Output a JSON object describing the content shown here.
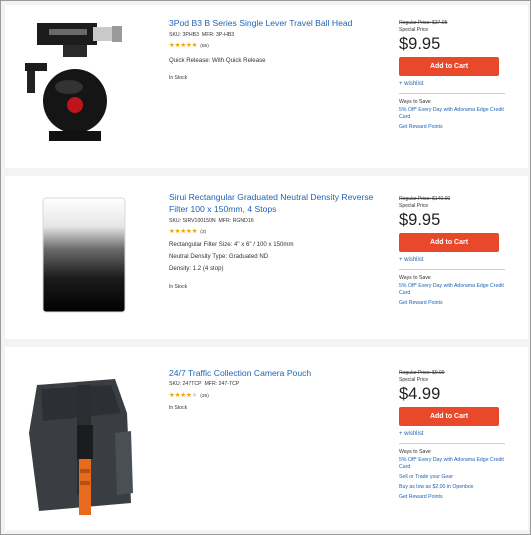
{
  "products": [
    {
      "title": "3Pod B3 B Series Single Lever Travel Ball Head",
      "sku_label": "SKU: 3PHB3",
      "mfr_label": "MFR: 3P-HB3",
      "rating": 4.5,
      "rating_count": "(55)",
      "features": [
        "Quick Release: With Quick Release"
      ],
      "stock": "In Stock",
      "regular_price": "Regular Price: $37.95",
      "special_label": "Special Price",
      "price": "$9.95",
      "cart_label": "Add to Cart",
      "wishlist_label": "+ wishlist",
      "ways_label": "Ways to Save",
      "save_links": [
        "5% Off* Every Day with Adorama Edge Credit Card",
        "Get Reward Points"
      ]
    },
    {
      "title": "Sirui Rectangular Graduated Neutral Density Reverse Filter 100 x 150mm, 4 Stops",
      "sku_label": "SKU: SIRV100150N",
      "mfr_label": "MFR: RGND16",
      "rating": 4.5,
      "rating_count": "(3)",
      "features": [
        "Rectangular Filter Size: 4\" x 6\" / 100 x 150mm",
        "Neutral Density Type: Graduated ND",
        "Density: 1.2 (4 stop)"
      ],
      "stock": "In Stock",
      "regular_price": "Regular Price: $140.00",
      "special_label": "Special Price",
      "price": "$9.95",
      "cart_label": "Add to Cart",
      "wishlist_label": "+ wishlist",
      "ways_label": "Ways to Save",
      "save_links": [
        "5% Off* Every Day with Adorama Edge Credit Card",
        "Get Reward Points"
      ]
    },
    {
      "title": "24/7 Traffic Collection Camera Pouch",
      "sku_label": "SKU: 247TCP",
      "mfr_label": "MFR: 247-TCP",
      "rating": 3.5,
      "rating_count": "(25)",
      "features": [],
      "stock": "In Stock",
      "regular_price": "Regular Price: $9.99",
      "special_label": "Special Price",
      "price": "$4.99",
      "cart_label": "Add to Cart",
      "wishlist_label": "+ wishlist",
      "ways_label": "Ways to Save",
      "save_links": [
        "5% Off* Every Day with Adorama Edge Credit Card",
        "Sell or Trade your Gear",
        "Buy as low as $2.00 in Openbox",
        "Get Reward Points"
      ]
    }
  ],
  "colors": {
    "link": "#1f63b4",
    "cart": "#e8492a",
    "star": "#f0a202"
  }
}
